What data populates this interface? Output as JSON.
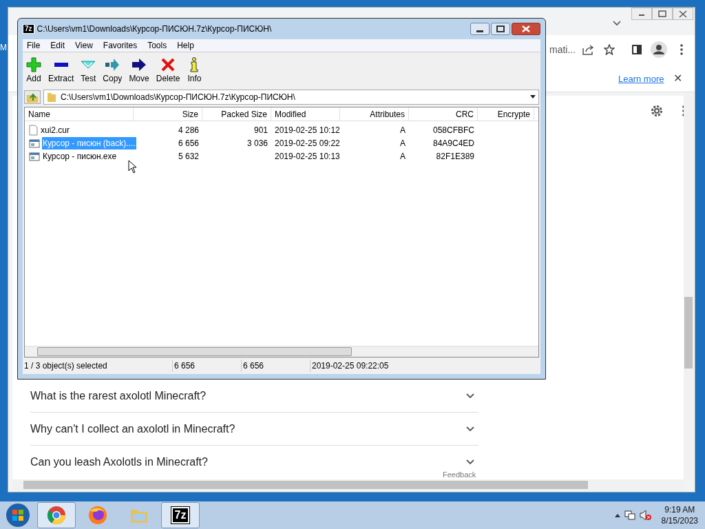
{
  "desktop_fragment": "M",
  "browser": {
    "address_text": "mati...",
    "info_bar": {
      "link": "Learn more",
      "close": "✕"
    },
    "faq": [
      {
        "question": "What is the rarest axolotl Minecraft?"
      },
      {
        "question": "Why can't I collect an axolotl in Minecraft?"
      },
      {
        "question": "Can you leash Axolotls in Minecraft?"
      }
    ],
    "feedback": "Feedback"
  },
  "window": {
    "title": "C:\\Users\\vm1\\Downloads\\Курсор-ПИСЮН.7z\\Курсор-ПИСЮН\\",
    "app_icon": "7z",
    "menu": [
      "File",
      "Edit",
      "View",
      "Favorites",
      "Tools",
      "Help"
    ],
    "toolbar": [
      {
        "kind": "add",
        "label": "Add"
      },
      {
        "kind": "extract",
        "label": "Extract"
      },
      {
        "kind": "test",
        "label": "Test"
      },
      {
        "kind": "copy",
        "label": "Copy"
      },
      {
        "kind": "move",
        "label": "Move"
      },
      {
        "kind": "delete",
        "label": "Delete"
      },
      {
        "kind": "info",
        "label": "Info"
      }
    ],
    "path": "C:\\Users\\vm1\\Downloads\\Курсор-ПИСЮН.7z\\Курсор-ПИСЮН\\",
    "table": {
      "columns": [
        "Name",
        "Size",
        "Packed Size",
        "Modified",
        "Attributes",
        "CRC",
        "Encrypte"
      ],
      "rows": [
        {
          "kind": "file",
          "selected": false,
          "cells": [
            "xui2.cur",
            "4 286",
            "901",
            "2019-02-25 10:12",
            "A",
            "058CFBFC"
          ]
        },
        {
          "kind": "exe",
          "selected": true,
          "cells": [
            "Курсор - писюн (back)....",
            "6 656",
            "3 036",
            "2019-02-25 09:22",
            "A",
            "84A9C4ED"
          ]
        },
        {
          "kind": "exe",
          "selected": false,
          "cells": [
            "Курсор - писюн.exe",
            "5 632",
            "",
            "2019-02-25 10:13",
            "A",
            "82F1E389"
          ]
        }
      ]
    },
    "status_bar": [
      "1 / 3 object(s) selected",
      "6 656",
      "6 656",
      "2019-02-25 09:22:05"
    ]
  },
  "taskbar": {
    "apps": [
      {
        "kind": "chrome",
        "selected": true
      },
      {
        "kind": "firefox",
        "selected": false
      },
      {
        "kind": "explorer",
        "selected": false
      },
      {
        "kind": "sevenzip",
        "selected": true,
        "label": "7z"
      }
    ],
    "time": "9:19 AM",
    "date": "8/15/2023"
  }
}
